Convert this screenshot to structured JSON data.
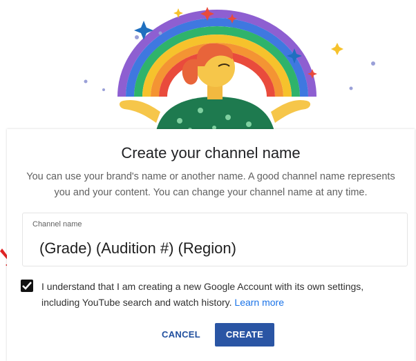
{
  "dialog": {
    "title": "Create your channel name",
    "subtitle": "You can use your brand's name or another name. A good channel name represents you and your content. You can change your channel name at any time.",
    "field_label": "Channel name",
    "field_value": "(Grade) (Audition #) (Region)",
    "checkbox_checked": true,
    "consent_text": "I understand that I am creating a new Google Account with its own settings, including YouTube search and watch history.",
    "learn_more": "Learn more",
    "cancel_label": "CANCEL",
    "create_label": "CREATE"
  },
  "colors": {
    "accent": "#2a55a4",
    "link": "#1a73e8",
    "arrow": "#e02424"
  },
  "icons": [
    "rainbow-illustration",
    "check-icon",
    "red-arrow-icon"
  ]
}
